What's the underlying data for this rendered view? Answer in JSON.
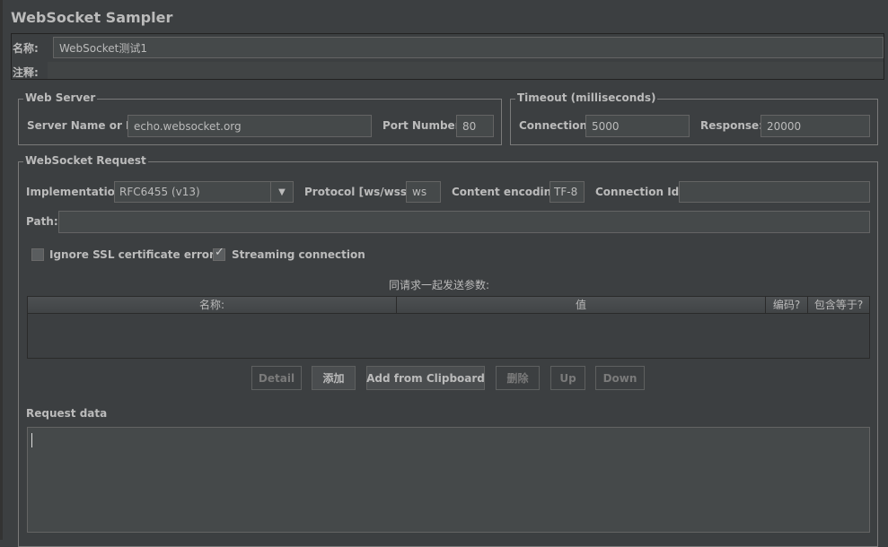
{
  "title": "WebSocket Sampler",
  "name_label": "名称:",
  "name_value": "WebSocket测试1",
  "comment_label": "注释:",
  "comment_value": "",
  "web_server": {
    "legend": "Web Server",
    "server_label": "Server Name or IP:",
    "server_value": "echo.websocket.org",
    "port_label": "Port Number:",
    "port_value": "80"
  },
  "timeout": {
    "legend": "Timeout (milliseconds)",
    "connection_label": "Connection:",
    "connection_value": "5000",
    "response_label": "Response:",
    "response_value": "20000"
  },
  "request": {
    "legend": "WebSocket Request",
    "impl_label": "Implementation:",
    "impl_value": "RFC6455 (v13)",
    "protocol_label": "Protocol [ws/wss]:",
    "protocol_value": "ws",
    "encoding_label": "Content encoding:",
    "encoding_value": "TF-8",
    "connid_label": "Connection Id:",
    "connid_value": "",
    "path_label": "Path:",
    "path_value": "",
    "ignore_ssl": {
      "label": "Ignore SSL certificate errors",
      "checked": false
    },
    "streaming": {
      "label": "Streaming connection",
      "checked": true
    },
    "params_title": "同请求一起发送参数:",
    "columns": [
      "名称:",
      "值",
      "编码?",
      "包含等于?"
    ],
    "buttons": [
      {
        "label": "Detail",
        "enabled": false
      },
      {
        "label": "添加",
        "enabled": true
      },
      {
        "label": "Add from Clipboard",
        "enabled": true
      },
      {
        "label": "删除",
        "enabled": false
      },
      {
        "label": "Up",
        "enabled": false
      },
      {
        "label": "Down",
        "enabled": false
      }
    ],
    "request_data_label": "Request data",
    "request_data_value": ""
  }
}
